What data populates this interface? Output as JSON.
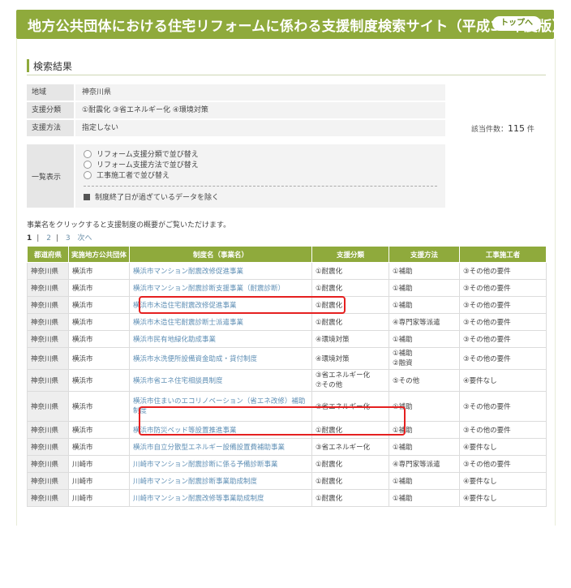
{
  "header": {
    "title": "地方公共団体における住宅リフォームに係わる支援制度検索サイト（平成30年度版）",
    "top_button": "トップへ"
  },
  "section_title": "検索結果",
  "conditions": [
    {
      "label": "地域",
      "value": "神奈川県"
    },
    {
      "label": "支援分類",
      "value": "①耐震化 ③省エネルギー化 ④環境対策"
    },
    {
      "label": "支援方法",
      "value": "指定しない"
    }
  ],
  "count": {
    "prefix": "該当件数：",
    "number": "115",
    "suffix": "件"
  },
  "display": {
    "label": "一覧表示",
    "options": [
      "リフォーム支援分類で並び替え",
      "リフォーム支援方法で並び替え",
      "工事施工者で並び替え"
    ],
    "checkbox": "制度終了日が過ぎているデータを除く"
  },
  "note": "事業名をクリックすると支援制度の概要がご覧いただけます。",
  "pager": {
    "pages": [
      "1",
      "2",
      "3"
    ],
    "next": "次へ"
  },
  "table": {
    "headers": [
      "都道府県",
      "実施地方公共団体",
      "制度名（事業名）",
      "支援分類",
      "支援方法",
      "工事施工者"
    ],
    "rows": [
      [
        "神奈川県",
        "横浜市",
        "横浜市マンション耐震改修促進事業",
        "①耐震化",
        "①補助",
        "③その他の要件"
      ],
      [
        "神奈川県",
        "横浜市",
        "横浜市マンション耐震診断支援事業（耐震診断）",
        "①耐震化",
        "①補助",
        "③その他の要件"
      ],
      [
        "神奈川県",
        "横浜市",
        "横浜市木造住宅耐震改修促進事業",
        "①耐震化",
        "①補助",
        "③その他の要件"
      ],
      [
        "神奈川県",
        "横浜市",
        "横浜市木造住宅耐震診断士派遣事業",
        "①耐震化",
        "④専門家等派遣",
        "③その他の要件"
      ],
      [
        "神奈川県",
        "横浜市",
        "横浜市民有地緑化助成事業",
        "④環境対策",
        "①補助",
        "③その他の要件"
      ],
      [
        "神奈川県",
        "横浜市",
        "横浜市水洗便所設備資金助成・貸付制度",
        "④環境対策",
        "①補助\n②融資",
        "③その他の要件"
      ],
      [
        "神奈川県",
        "横浜市",
        "横浜市省エネ住宅相談員制度",
        "③省エネルギー化\n⑦その他",
        "⑤その他",
        "④要件なし"
      ],
      [
        "神奈川県",
        "横浜市",
        "横浜市住まいのエコリノベーション（省エネ改修）補助制度",
        "③省エネルギー化",
        "①補助",
        "③その他の要件"
      ],
      [
        "神奈川県",
        "横浜市",
        "横浜市防災ベッド等設置推進事業",
        "①耐震化",
        "①補助",
        "③その他の要件"
      ],
      [
        "神奈川県",
        "横浜市",
        "横浜市自立分散型エネルギー設備設置費補助事業",
        "③省エネルギー化",
        "①補助",
        "④要件なし"
      ],
      [
        "神奈川県",
        "川崎市",
        "川崎市マンション耐震診断に係る予備診断事業",
        "①耐震化",
        "④専門家等派遣",
        "③その他の要件"
      ],
      [
        "神奈川県",
        "川崎市",
        "川崎市マンション耐震診断事業助成制度",
        "①耐震化",
        "①補助",
        "④要件なし"
      ],
      [
        "神奈川県",
        "川崎市",
        "川崎市マンション耐震改修等事業助成制度",
        "①耐震化",
        "①補助",
        "④要件なし"
      ]
    ]
  },
  "colors": {
    "accent": "#8faa3c",
    "link": "#5f8fb5",
    "highlight": "#e52020"
  }
}
